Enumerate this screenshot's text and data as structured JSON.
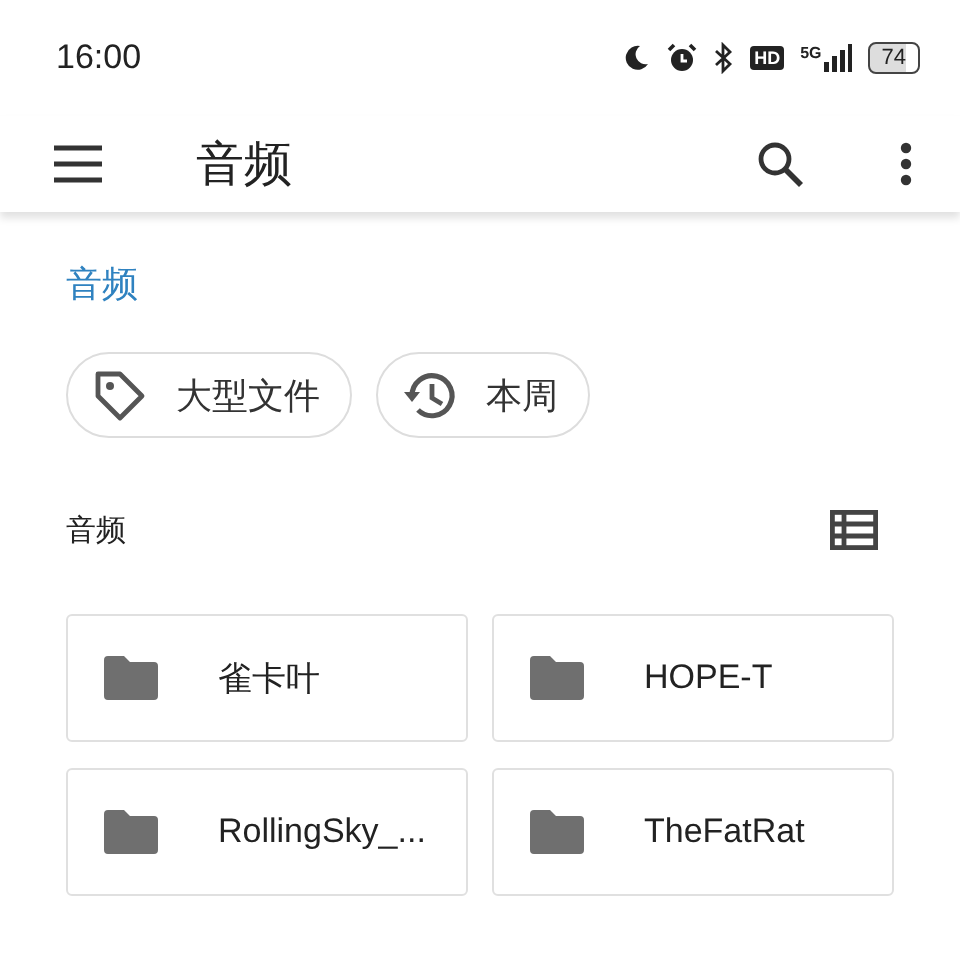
{
  "status_bar": {
    "time": "16:00",
    "hd": "HD",
    "network": "5G",
    "battery": "74"
  },
  "app_bar": {
    "title": "音频"
  },
  "breadcrumb": "音频",
  "chips": [
    {
      "kind": "tag",
      "label": "大型文件"
    },
    {
      "kind": "history",
      "label": "本周"
    }
  ],
  "section": {
    "title": "音频"
  },
  "folders": [
    {
      "name": "雀卡叶"
    },
    {
      "name": "HOPE-T"
    },
    {
      "name": "RollingSky_..."
    },
    {
      "name": "TheFatRat"
    }
  ]
}
